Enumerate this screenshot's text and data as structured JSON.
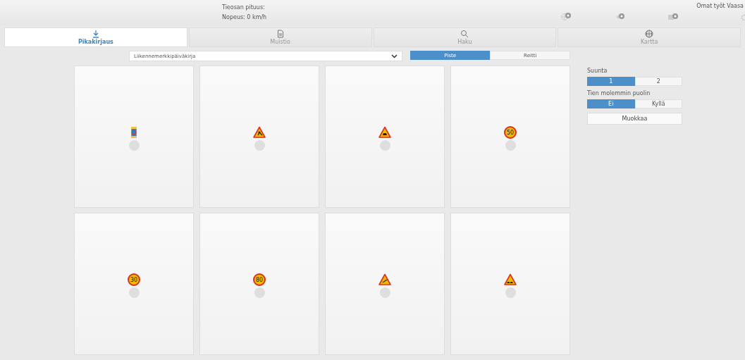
{
  "header": {
    "road_length_label": "Tieosan pituus:",
    "speed_label": "Nopeus:",
    "speed_value": "0 km/h",
    "user": "Omat työt Vaasa"
  },
  "tabs": [
    {
      "label": "Pikakirjaus",
      "selected": true
    },
    {
      "label": "Muistio",
      "selected": false
    },
    {
      "label": "Haku",
      "selected": false
    },
    {
      "label": "Kartta",
      "selected": false
    }
  ],
  "log_select": {
    "value": "Liikennemerkkipäiväkirja"
  },
  "mode": [
    {
      "label": "Piste",
      "selected": true
    },
    {
      "label": "Reitti",
      "selected": false
    }
  ],
  "signs": [
    {
      "kind": "info"
    },
    {
      "kind": "roadwork"
    },
    {
      "kind": "warning"
    },
    {
      "kind": "speed",
      "label": "50"
    },
    {
      "kind": "speed",
      "label": "30"
    },
    {
      "kind": "speed",
      "label": "80"
    },
    {
      "kind": "slippery"
    },
    {
      "kind": "bumps"
    }
  ],
  "panel": {
    "direction_label": "Suunta",
    "direction": [
      {
        "label": "1",
        "selected": true
      },
      {
        "label": "2",
        "selected": false
      }
    ],
    "both_sides_label": "Tien molemmin puolin",
    "both_sides": [
      {
        "label": "Ei",
        "selected": true
      },
      {
        "label": "Kyllä",
        "selected": false
      }
    ],
    "edit_button": "Muokkaa"
  }
}
